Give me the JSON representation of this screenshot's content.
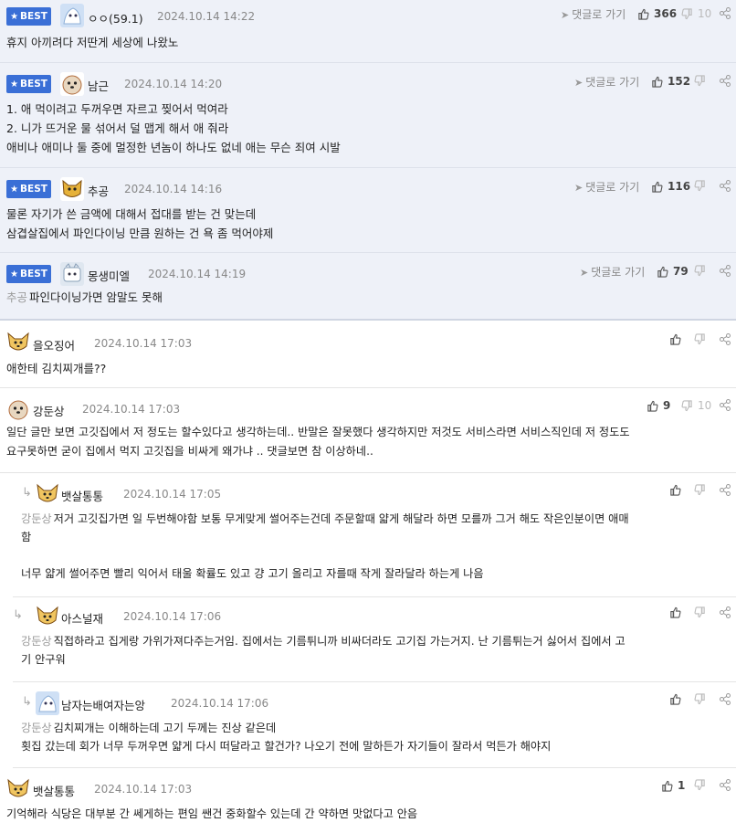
{
  "labels": {
    "best": "BEST",
    "reply_link": "댓글로 가기"
  },
  "comments": [
    {
      "nick": "ㅇㅇ(59.1)",
      "date": "2024.10.14 14:22",
      "up": "366",
      "down": "10",
      "body": [
        "휴지 아끼려다 저딴게 세상에 나왔노"
      ]
    },
    {
      "nick": "남근",
      "date": "2024.10.14 14:20",
      "up": "152",
      "down": "",
      "body": [
        "1. 애 먹이려고 두꺼우면 자르고 찢어서 먹여라",
        "2. 니가 뜨거운 물 섞어서 덜 맵게 해서 애 줘라",
        "애비나 애미나 둘 중에 멀정한 년놈이 하나도 없네 애는 무슨 죄여 시발"
      ]
    },
    {
      "nick": "추공",
      "date": "2024.10.14 14:16",
      "up": "116",
      "down": "",
      "body": [
        "물론 자기가 쓴 금액에 대해서 접대를 받는 건 맞는데",
        "삼겹살집에서 파인다이닝 만큼 원하는 건 욕 좀 먹어야제"
      ]
    },
    {
      "nick": "몽생미엘",
      "date": "2024.10.14 14:19",
      "up": "79",
      "down": "",
      "mention": "추공",
      "body": [
        "파인다이닝가면 암말도 못해"
      ]
    },
    {
      "nick": "을오징어",
      "date": "2024.10.14 17:03",
      "up": "",
      "down": "",
      "body": [
        "애한테 김치찌개를??"
      ]
    },
    {
      "nick": "강둔상",
      "date": "2024.10.14 17:03",
      "up": "9",
      "down": "10",
      "body": [
        "일단 글만 보면 고깃집에서 저 정도는 할수있다고 생각하는데.. 반말은 잘못했다 생각하지만 저것도 서비스라면 서비스직인데 저 정도도",
        "요구못하면 굳이 집에서 먹지 고깃집을 비싸게 왜가냐 .. 댓글보면 참 이상하네.."
      ]
    },
    {
      "nick": "뱃살통통",
      "date": "2024.10.14 17:05",
      "up": "",
      "down": "",
      "mention": "강둔상",
      "body": [
        "저거 고깃집가면 일 두번해야함 보통 무게맞게 썰어주는건데 주문할때 얇게 해달라 하면 모를까 그거 해도 작은인분이면 애매",
        "함",
        "",
        "너무 얇게 썰어주면 빨리 익어서 태울 확률도 있고 걍 고기 올리고 자를때 작게 잘라달라 하는게 나음"
      ]
    },
    {
      "nick": "아스널재",
      "date": "2024.10.14 17:06",
      "up": "",
      "down": "",
      "mention": "강둔상",
      "body": [
        "직접하라고 집게랑 가위가져다주는거임. 집에서는 기름튀니까 비싸더라도 고기집 가는거지. 난 기름튀는거 싫어서 집에서 고",
        "기 안구워"
      ]
    },
    {
      "nick": "남자는배여자는앙",
      "date": "2024.10.14 17:06",
      "up": "",
      "down": "",
      "mention": "강둔상",
      "body": [
        "김치찌개는 이해하는데 고기 두께는 진상 같은데",
        "횟집 갔는데 회가 너무 두꺼우면 얇게 다시 떠달라고 할건가? 나오기 전에 말하든가 자기들이 잘라서 먹든가 해야지"
      ]
    },
    {
      "nick": "뱃살통통",
      "date": "2024.10.14 17:03",
      "up": "1",
      "down": "",
      "body": [
        "기억해라 식당은 대부분 간 쎄게하는 편임 쌘건 중화할수 있는데 간 약하면 맛없다고 안음"
      ]
    }
  ]
}
